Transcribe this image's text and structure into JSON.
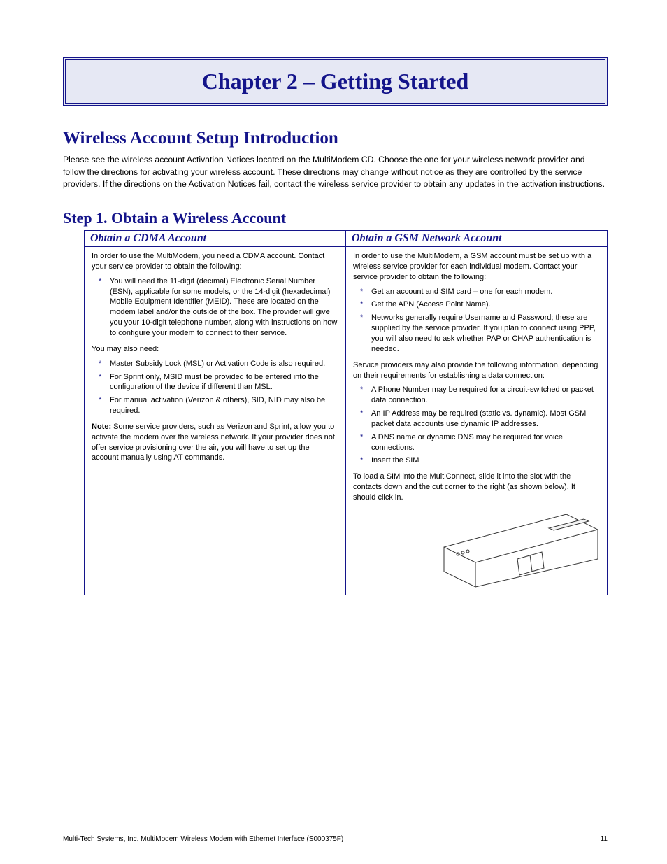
{
  "banner": "Chapter 2 – Getting Started",
  "section": "Wireless Account Setup Introduction",
  "intro": "Please see the wireless account Activation Notices located on the MultiModem CD. Choose the one for your wireless network provider and follow the directions for activating your wireless account. These directions may change without notice as they are controlled by the service providers. If the directions on the Activation Notices fail, contact the wireless service provider to obtain any updates in the activation instructions.",
  "stepHeading": "Step 1.  Obtain a Wireless Account",
  "cols": {
    "left": "Obtain a CDMA Account",
    "right": "Obtain a GSM Network Account"
  },
  "cdma": {
    "p1": "In order to use the MultiModem, you need a CDMA account. Contact your service provider to obtain the following:",
    "b1": "You will need the 11-digit (decimal) Electronic Serial Number (ESN), applicable for some models, or the 14-digit (hexadecimal) Mobile Equipment Identifier (MEID). These are located on the modem label and/or the outside of the box. The provider will give you your 10-digit telephone number, along with instructions on how to configure your modem to connect to their service.",
    "p2": "You may also need:",
    "b2": "Master Subsidy Lock (MSL) or Activation Code is also required.",
    "b3": "For Sprint only, MSID must be provided to be entered into the configuration of the device if different than MSL.",
    "b4": "For manual activation (Verizon & others), SID, NID may also be required.",
    "noteH": "Note:",
    "note": " Some service providers, such as Verizon and Sprint, allow you to activate the modem over the wireless network. If your provider does not offer service provisioning over the air, you will have to set up the account manually using AT commands."
  },
  "gsm": {
    "p1": "In order to use the MultiModem, a GSM account must be set up with a wireless service provider for each individual modem. Contact your service provider to obtain the following:",
    "b1": "Get an account and SIM card – one for each modem.",
    "b2": "Get the APN (Access Point Name).",
    "b3": "Networks generally require Username and Password; these are supplied by the service provider. If you plan to connect using PPP, you will also need to ask whether PAP or CHAP authentication is needed.",
    "p2": "Service providers may also provide the following information, depending on their requirements for establishing a data connection:",
    "b4": "A Phone Number may be required for a circuit-switched or packet data connection.",
    "b5": "An IP Address may be required (static vs. dynamic). Most GSM packet data accounts use dynamic IP addresses.",
    "b6": "A DNS name or dynamic DNS may be required for voice connections.",
    "b7": "Insert the SIM",
    "simText": "To load a SIM into the MultiConnect, slide it into the slot with the contacts down and the cut corner to the right (as shown below). It should click in."
  },
  "footer": {
    "left": "Multi-Tech Systems, Inc. MultiModem Wireless Modem with Ethernet Interface (S000375F)",
    "right": "11"
  }
}
